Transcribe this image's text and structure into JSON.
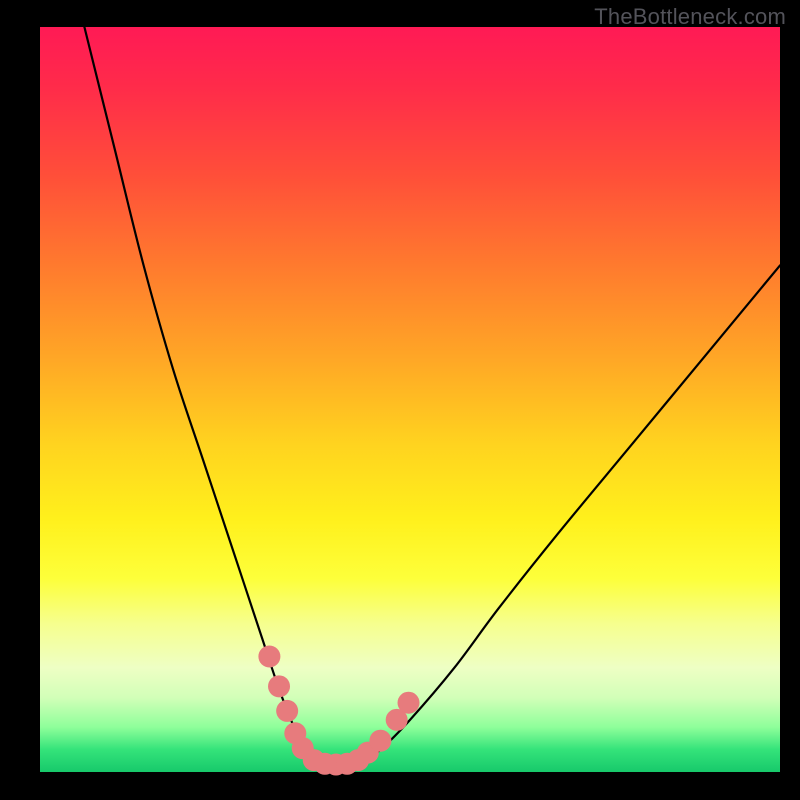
{
  "watermark": "TheBottleneck.com",
  "chart_data": {
    "type": "line",
    "title": "",
    "xlabel": "",
    "ylabel": "",
    "xlim": [
      0,
      100
    ],
    "ylim": [
      0,
      100
    ],
    "grid": false,
    "series": [
      {
        "name": "bottleneck-curve",
        "x": [
          6,
          10,
          14,
          18,
          22,
          26,
          28,
          30,
          32,
          33.5,
          35,
          36,
          37,
          38,
          40,
          42,
          44,
          46,
          50,
          56,
          62,
          70,
          80,
          90,
          100
        ],
        "values": [
          100,
          84,
          68,
          54,
          42,
          30,
          24,
          18,
          12,
          8,
          4.5,
          2.5,
          1.5,
          1.2,
          1.0,
          1.2,
          1.8,
          3.0,
          7,
          14,
          22,
          32,
          44,
          56,
          68
        ]
      }
    ],
    "markers": {
      "name": "highlight-dots",
      "color": "#e77b7d",
      "points": [
        {
          "x": 31.0,
          "y": 15.5
        },
        {
          "x": 32.3,
          "y": 11.5
        },
        {
          "x": 33.4,
          "y": 8.2
        },
        {
          "x": 34.5,
          "y": 5.2
        },
        {
          "x": 35.5,
          "y": 3.2
        },
        {
          "x": 37.0,
          "y": 1.6
        },
        {
          "x": 38.5,
          "y": 1.1
        },
        {
          "x": 40.0,
          "y": 1.0
        },
        {
          "x": 41.5,
          "y": 1.1
        },
        {
          "x": 43.0,
          "y": 1.6
        },
        {
          "x": 44.3,
          "y": 2.6
        },
        {
          "x": 46.0,
          "y": 4.2
        },
        {
          "x": 48.2,
          "y": 7.0
        },
        {
          "x": 49.8,
          "y": 9.3
        }
      ]
    }
  }
}
